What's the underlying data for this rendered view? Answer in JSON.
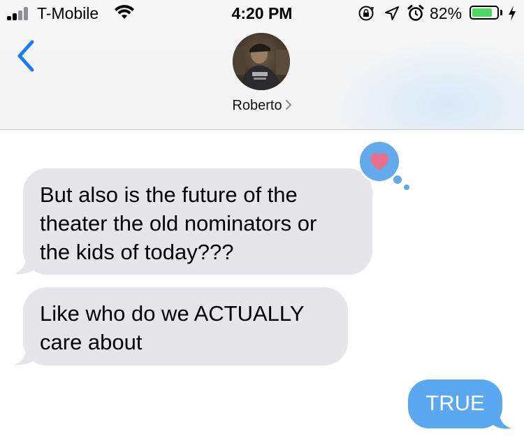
{
  "status_bar": {
    "carrier": "T-Mobile",
    "time": "4:20 PM",
    "battery_percent": "82%",
    "battery_level": 0.82,
    "icons": [
      "signal-icon",
      "wifi-icon",
      "rotation-lock-icon",
      "location-icon",
      "alarm-icon",
      "battery-icon",
      "charging-icon"
    ]
  },
  "header": {
    "back_icon": "chevron-left-icon",
    "contact_name": "Roberto",
    "contact_chevron": "chevron-right-icon",
    "avatar": "contact-avatar"
  },
  "messages": [
    {
      "direction": "incoming",
      "lines": [
        "But also is the future of the",
        "theater the old nominators or",
        "the kids of today???"
      ],
      "tapback": "heart-icon"
    },
    {
      "direction": "incoming",
      "lines": [
        "Like who do we ACTUALLY",
        "care about"
      ]
    },
    {
      "direction": "outgoing",
      "lines": [
        "TRUE"
      ]
    }
  ],
  "colors": {
    "incoming_bubble": "#e5e5ea",
    "outgoing_bubble": "#5aa8f0",
    "tapback_bubble": "#62aaeb",
    "heart": "#e8708e",
    "accent": "#1a7cf5",
    "battery": "#4cd964"
  }
}
